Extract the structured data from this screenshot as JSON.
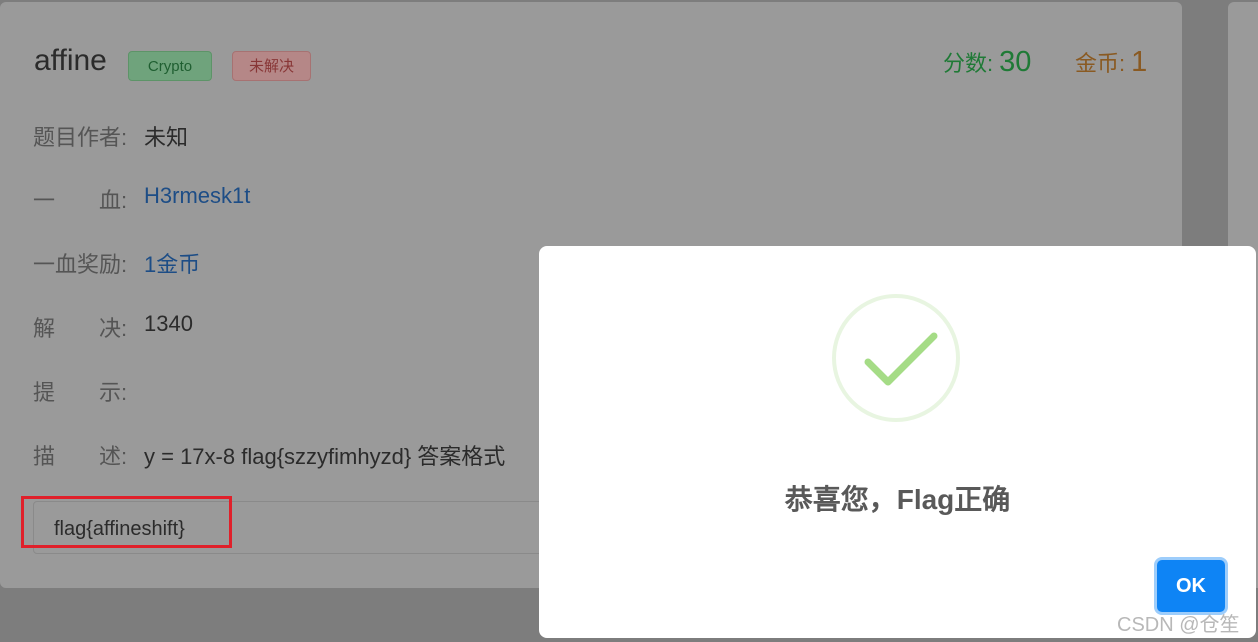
{
  "challenge": {
    "title": "affine",
    "category": "Crypto",
    "status": "未解决",
    "score_label": "分数:",
    "score_value": "30",
    "coins_label": "金币:",
    "coins_value": "1"
  },
  "details": [
    {
      "label": "题目作者:",
      "value": "未知"
    },
    {
      "label": "一　　血:",
      "value": "H3rmesk1t"
    },
    {
      "label": "一血奖励:",
      "value": "1金币"
    },
    {
      "label": "解　　决:",
      "value": "1340"
    },
    {
      "label": "提　　示:",
      "value": ""
    },
    {
      "label": "描　　述:",
      "value": "y = 17x-8 flag{szzyfimhyzd} 答案格式"
    }
  ],
  "flag_input": {
    "value": "flag{affineshift}"
  },
  "modal": {
    "title": "恭喜您，Flag正确",
    "ok_label": "OK"
  },
  "watermark": "CSDN @仓笙",
  "colors": {
    "success": "#a5dc86",
    "ok_button": "#0e84f5",
    "highlight": "#e0202a"
  }
}
